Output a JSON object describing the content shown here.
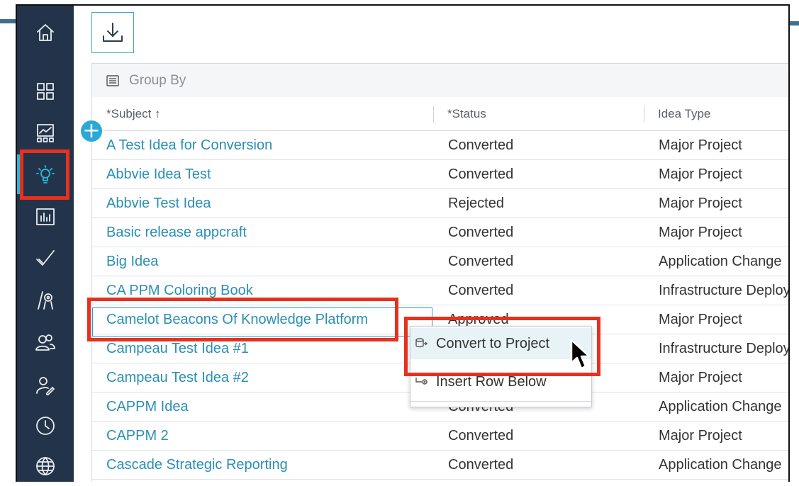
{
  "sidebar": {
    "items": [
      {
        "name": "home-icon"
      },
      {
        "name": "dashboard-grid-icon"
      },
      {
        "name": "roadmap-icon"
      },
      {
        "name": "ideas-lightbulb-icon",
        "active": true
      },
      {
        "name": "reports-chart-icon"
      },
      {
        "name": "tasks-check-icon"
      },
      {
        "name": "resources-icon"
      },
      {
        "name": "teams-icon"
      },
      {
        "name": "user-edit-icon"
      },
      {
        "name": "timesheets-clock-icon"
      },
      {
        "name": "global-icon"
      }
    ]
  },
  "toolbar": {
    "download_icon": "download-icon"
  },
  "grid": {
    "group_by_label": "Group By",
    "columns": {
      "subject": "*Subject ↑",
      "status": "*Status",
      "idea_type": "Idea Type"
    },
    "rows": [
      {
        "subject": "A Test Idea for Conversion",
        "status": "Converted",
        "idea_type": "Major Project"
      },
      {
        "subject": "Abbvie Idea Test",
        "status": "Converted",
        "idea_type": "Major Project"
      },
      {
        "subject": "Abbvie Test Idea",
        "status": "Rejected",
        "idea_type": "Major Project"
      },
      {
        "subject": "Basic release appcraft",
        "status": "Converted",
        "idea_type": "Major Project"
      },
      {
        "subject": "Big Idea",
        "status": "Converted",
        "idea_type": "Application Change"
      },
      {
        "subject": "CA PPM Coloring Book",
        "status": "Converted",
        "idea_type": "Infrastructure Deployment"
      },
      {
        "subject": "Camelot Beacons Of Knowledge Platform",
        "status": "Approved",
        "idea_type": "Major Project"
      },
      {
        "subject": "Campeau Test Idea #1",
        "status": "",
        "idea_type": "Infrastructure Deployment"
      },
      {
        "subject": "Campeau Test Idea #2",
        "status": "",
        "idea_type": "Major Project"
      },
      {
        "subject": "CAPPM Idea",
        "status": "Converted",
        "idea_type": "Application Change"
      },
      {
        "subject": "CAPPM 2",
        "status": "Converted",
        "idea_type": "Major Project"
      },
      {
        "subject": "Cascade Strategic Reporting",
        "status": "Converted",
        "idea_type": "Application Change"
      }
    ]
  },
  "context_menu": {
    "items": [
      {
        "label": "Convert to Project",
        "icon": "convert-project-icon"
      },
      {
        "label": "Insert Row Below",
        "icon": "insert-row-icon"
      }
    ]
  },
  "colors": {
    "sidebar_bg": "#23344a",
    "accent": "#2ab9df",
    "link": "#2a8fb4",
    "highlight_red": "#e8301e"
  }
}
